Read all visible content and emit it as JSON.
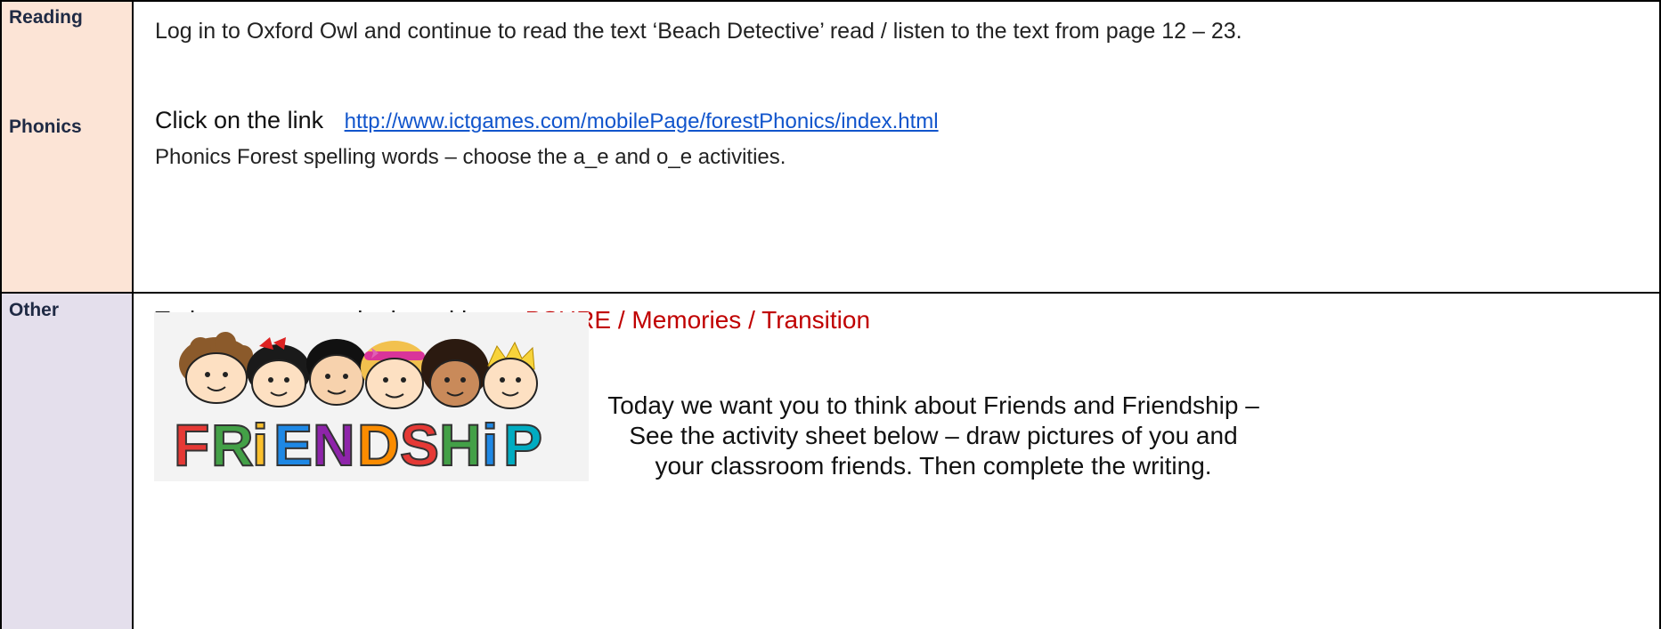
{
  "rows": {
    "reading": {
      "label": "Reading",
      "text": "Log in to Oxford Owl and continue to read the text ‘Beach Detective’ read / listen to the text from page 12 – 23."
    },
    "phonics": {
      "label": "Phonics",
      "click_prefix": "Click on the link",
      "link": "http://www.ictgames.com/mobilePage/forestPhonics/index.html",
      "instructions": "Phonics Forest spelling words – choose the a_e and o_e activities."
    },
    "other": {
      "label": "Other",
      "intro": "Today we are continuing with our ",
      "topic": "PSHRE / Memories / Transition",
      "friends_line1": "Today we want you to think about Friends and Friendship –",
      "friends_line2": "See the activity sheet below – draw pictures of you and your classroom friends. Then complete the writing.",
      "banner_word": "FRiENDSHiP"
    }
  },
  "colors": {
    "reading_phonics_bg": "#fce4d6",
    "other_bg": "#e4dfec",
    "link": "#1155cc",
    "topic_accent": "#c00000"
  }
}
